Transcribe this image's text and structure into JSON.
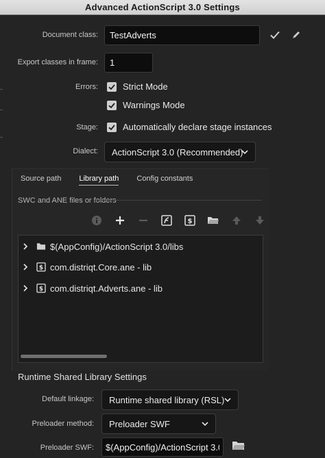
{
  "window": {
    "title": "Advanced ActionScript 3.0 Settings"
  },
  "document_class": {
    "label": "Document class:",
    "value": "TestAdverts"
  },
  "export_frame": {
    "label": "Export classes in frame:",
    "value": "1"
  },
  "errors": {
    "label": "Errors:",
    "strict_mode": {
      "label": "Strict Mode",
      "checked": true
    },
    "warnings_mode": {
      "label": "Warnings Mode",
      "checked": true
    }
  },
  "stage": {
    "label": "Stage:",
    "auto_declare": {
      "label": "Automatically declare stage instances",
      "checked": true
    }
  },
  "dialect": {
    "label": "Dialect:",
    "value": "ActionScript 3.0 (Recommended)"
  },
  "tabs": [
    {
      "label": "Source path",
      "active": false
    },
    {
      "label": "Library path",
      "active": true
    },
    {
      "label": "Config constants",
      "active": false
    }
  ],
  "library": {
    "heading": "SWC and ANE files or folders",
    "toolbar": [
      "info-icon",
      "add-icon",
      "remove-icon",
      "flash-icon",
      "swc-icon",
      "folder-icon",
      "move-up-icon",
      "move-down-icon"
    ],
    "items": [
      {
        "label": "$(AppConfig)/ActionScript 3.0/libs",
        "icon": "folder-icon"
      },
      {
        "label": "com.distriqt.Core.ane - lib",
        "icon": "swc-icon"
      },
      {
        "label": "com.distriqt.Adverts.ane - lib",
        "icon": "swc-icon"
      }
    ]
  },
  "rsl": {
    "heading": "Runtime Shared Library Settings",
    "default_linkage": {
      "label": "Default linkage:",
      "value": "Runtime shared library (RSL)"
    },
    "preloader_method": {
      "label": "Preloader method:",
      "value": "Preloader SWF"
    },
    "preloader_swf": {
      "label": "Preloader SWF:",
      "value": "$(AppConfig)/ActionScript 3.0/r"
    }
  },
  "colors": {
    "background": "#242424",
    "field_bg": "#0d0d0d",
    "titlebar": "#d9d9d9"
  }
}
